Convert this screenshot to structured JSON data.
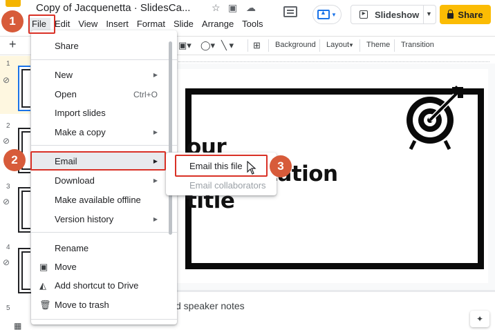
{
  "app": {
    "title": "Copy of Jacquenetta · SlidesCa...",
    "menus": [
      "File",
      "Edit",
      "View",
      "Insert",
      "Format",
      "Slide",
      "Arrange",
      "Tools"
    ]
  },
  "header": {
    "slideshow_label": "Slideshow",
    "share_label": "Share"
  },
  "toolbar": {
    "background": "Background",
    "layout": "Layout",
    "theme": "Theme",
    "transition": "Transition"
  },
  "filmstrip": {
    "slide_numbers": [
      "1",
      "2",
      "3",
      "4",
      "5"
    ]
  },
  "file_menu": {
    "items": [
      {
        "label": "Share",
        "shortcut": "",
        "submenu": false
      },
      {
        "label": "New",
        "shortcut": "",
        "submenu": true
      },
      {
        "label": "Open",
        "shortcut": "Ctrl+O",
        "submenu": false
      },
      {
        "label": "Import slides",
        "shortcut": "",
        "submenu": false
      },
      {
        "label": "Make a copy",
        "shortcut": "",
        "submenu": true
      },
      {
        "label": "Email",
        "shortcut": "",
        "submenu": true
      },
      {
        "label": "Download",
        "shortcut": "",
        "submenu": true
      },
      {
        "label": "Make available offline",
        "shortcut": "",
        "submenu": false
      },
      {
        "label": "Version history",
        "shortcut": "",
        "submenu": true
      },
      {
        "label": "Rename",
        "shortcut": "",
        "submenu": false
      },
      {
        "label": "Move",
        "shortcut": "",
        "submenu": false
      },
      {
        "label": "Add shortcut to Drive",
        "shortcut": "",
        "submenu": false
      },
      {
        "label": "Move to trash",
        "shortcut": "",
        "submenu": false
      }
    ]
  },
  "email_submenu": {
    "items": [
      {
        "label": "Email this file",
        "enabled": true
      },
      {
        "label": "Email collaborators",
        "enabled": false
      }
    ]
  },
  "slide": {
    "title_visible": "our presentation title"
  },
  "notes": {
    "placeholder_visible": "d speaker notes"
  },
  "steps": [
    "1",
    "2",
    "3"
  ],
  "colors": {
    "share": "#fbbc04",
    "highlight": "#d93025",
    "step_marker": "#d75b3a",
    "accent": "#1a73e8"
  }
}
